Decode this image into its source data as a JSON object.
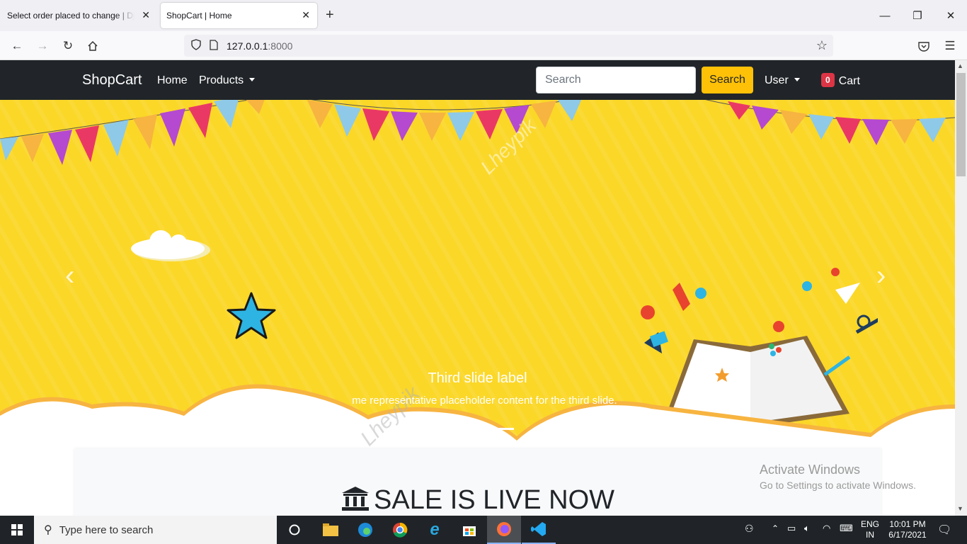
{
  "browser": {
    "tabs": [
      {
        "title": "Select order placed to change | Djan",
        "active": false
      },
      {
        "title": "ShopCart | Home",
        "active": true
      }
    ],
    "url_host": "127.0.0.1",
    "url_port": ":8000"
  },
  "site": {
    "brand": "ShopCart",
    "nav": {
      "home": "Home",
      "products": "Products",
      "user": "User"
    },
    "search": {
      "placeholder": "Search",
      "button": "Search"
    },
    "cart": {
      "count": "0",
      "label": "Cart"
    },
    "accent_colors": {
      "navbar": "#212529",
      "search_button": "#ffc107",
      "badge": "#dc3545",
      "carousel_bg": "#fbd728"
    }
  },
  "carousel": {
    "caption_title": "Third slide label",
    "caption_text": "me representative placeholder content for the third slide.",
    "active_index": 2,
    "indicator_count": 2,
    "watermark": "Lheypik"
  },
  "sale": {
    "title": "SALE IS LIVE NOW",
    "icon": "bank-icon"
  },
  "windows_notice": {
    "line1": "Activate Windows",
    "line2": "Go to Settings to activate Windows."
  },
  "taskbar": {
    "search_placeholder": "Type here to search",
    "lang_top": "ENG",
    "lang_bottom": "IN",
    "time": "10:01 PM",
    "date": "6/17/2021"
  }
}
